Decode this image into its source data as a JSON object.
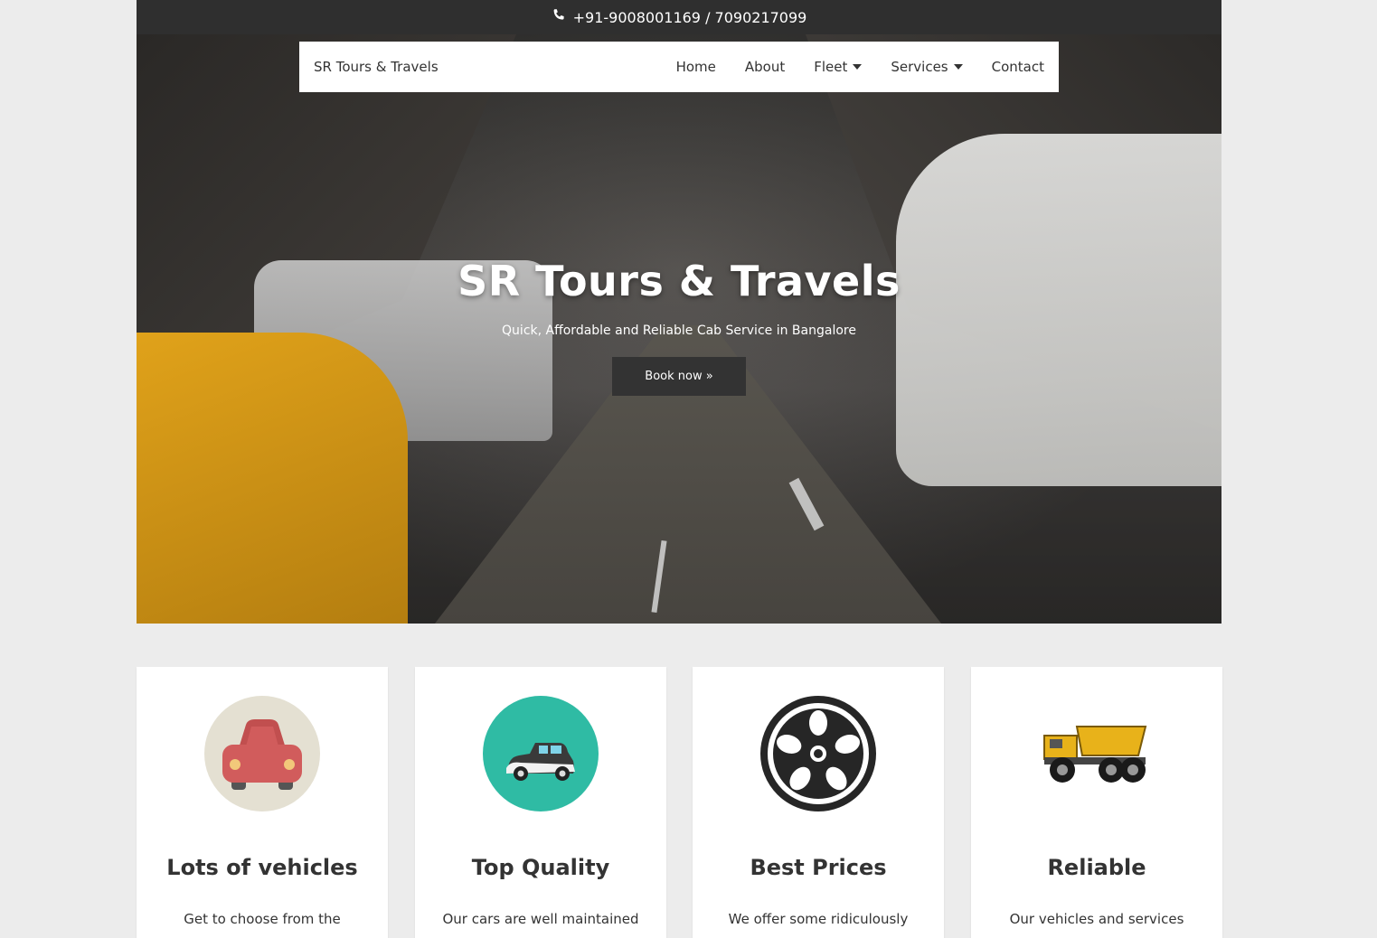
{
  "topbar": {
    "phone": "+91-9008001169 / 7090217099",
    "phone_icon": "phone-icon"
  },
  "nav": {
    "brand": "SR Tours & Travels",
    "items": [
      {
        "label": "Home",
        "dropdown": false
      },
      {
        "label": "About",
        "dropdown": false
      },
      {
        "label": "Fleet",
        "dropdown": true
      },
      {
        "label": "Services",
        "dropdown": true
      },
      {
        "label": "Contact",
        "dropdown": false
      }
    ]
  },
  "hero": {
    "title": "SR Tours & Travels",
    "subtitle": "Quick, Affordable and Reliable Cab Service in Bangalore",
    "button": "Book now »"
  },
  "features": [
    {
      "title": "Lots of vehicles",
      "text": "Get to choose from the",
      "icon": "car-icon"
    },
    {
      "title": "Top Quality",
      "text": "Our cars are well maintained",
      "icon": "classic-car-icon"
    },
    {
      "title": "Best Prices",
      "text": "We offer some ridiculously",
      "icon": "wheel-icon"
    },
    {
      "title": "Reliable",
      "text": "Our vehicles and services",
      "icon": "dump-truck-icon"
    }
  ],
  "colors": {
    "accent_teal": "#2fbba4",
    "car_red": "#d15c5c",
    "dark": "#333333",
    "truck_yellow": "#e8b21a"
  }
}
